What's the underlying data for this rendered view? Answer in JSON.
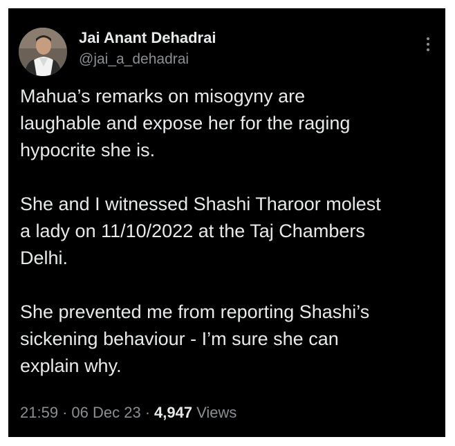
{
  "tweet": {
    "author_name": "Jai Anant Dehadrai",
    "author_handle": "@jai_a_dehadrai",
    "paragraphs": [
      "Mahua’s remarks on misogyny are\nlaughable and expose her for the raging\nhypocrite she is.",
      "She and I witnessed Shashi Tharoor molest\na lady on 11/10/2022 at the Taj Chambers\nDelhi.",
      "She prevented me from reporting Shashi’s\nsickening behaviour - I’m sure she can\nexplain why."
    ],
    "time": "21:59",
    "separator": "·",
    "date": "06 Dec 23",
    "views_count": "4,947",
    "views_label": "Views"
  },
  "icons": {
    "more": "more-vertical-icon"
  },
  "colors": {
    "background": "#000000",
    "text": "#e7e9ea",
    "secondary_text": "#8b8f94"
  }
}
